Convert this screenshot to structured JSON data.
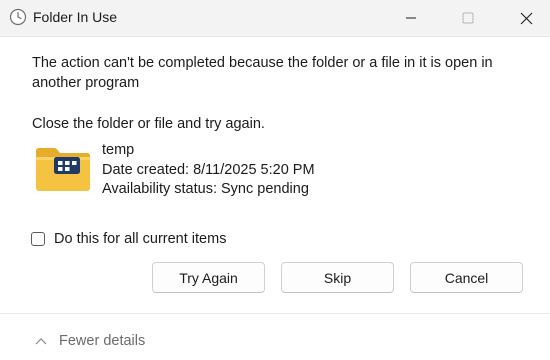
{
  "window": {
    "title": "Folder In Use",
    "icon": "clock-icon"
  },
  "titlebar_buttons": {
    "minimize": "minimize-icon",
    "maximize": "maximize-icon",
    "close": "close-icon"
  },
  "message": "The action can't be completed because the folder or a file in it is open in another program",
  "instruction": "Close the folder or file and try again.",
  "file": {
    "icon": "folder-icon",
    "name": "temp",
    "date_created": "Date created: 8/11/2025 5:20 PM",
    "availability": "Availability status: Sync pending"
  },
  "checkbox": {
    "label": "Do this for all current items",
    "checked": false
  },
  "buttons": {
    "try_again": "Try Again",
    "skip": "Skip",
    "cancel": "Cancel"
  },
  "details": {
    "label": "Fewer details",
    "icon": "chevron-up-icon"
  },
  "colors": {
    "titlebar_bg": "#f3f3f3",
    "folder_yellow": "#f5c342",
    "folder_tab": "#e6ac2a",
    "badge_navy": "#1f3a68"
  }
}
